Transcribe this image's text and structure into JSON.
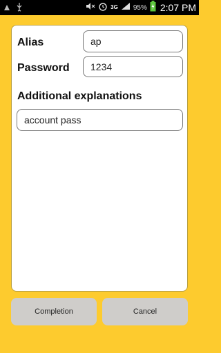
{
  "status_bar": {
    "battery_percent": "95%",
    "network": "3G",
    "time": "2:07 PM"
  },
  "form": {
    "alias_label": "Alias",
    "alias_value": "ap",
    "password_label": "Password",
    "password_value": "1234",
    "explanations_label": "Additional explanations",
    "explanations_value": "account pass"
  },
  "buttons": {
    "completion": "Completion",
    "cancel": "Cancel"
  },
  "colors": {
    "background": "#FDCB2E",
    "button": "#CFCDCA"
  }
}
